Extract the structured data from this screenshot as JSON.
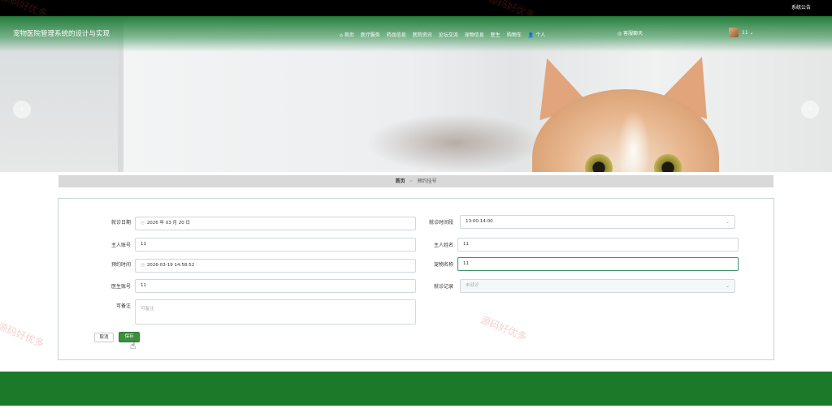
{
  "topbar": {
    "notice": "系统公告"
  },
  "watermark": "源码好优多",
  "nav": {
    "brand": "宠物医院管理系统的设计与实现",
    "items": [
      "⌂ 首页",
      "医疗服务",
      "药品信息",
      "医院资讯",
      "论坛交流",
      "宠物信息",
      "医生",
      "购物车",
      "👤 个人"
    ],
    "chat": "◎ 客服聊天",
    "user": "11 ⌄"
  },
  "carousel": {
    "prev": "‹",
    "next": "›"
  },
  "breadcrumb": {
    "home": "首页",
    "sep": ">",
    "current": "预约挂号"
  },
  "form": {
    "visit_date_label": "就诊日期",
    "visit_date_value": "2026 年 03 月 20 日",
    "slot_label": "就诊时间段",
    "slot_value": "13:00-14:00",
    "owner_account_label": "主人账号",
    "owner_account_value": "11",
    "owner_name_label": "主人姓名",
    "owner_name_value": "11",
    "booking_time_label": "预约时间",
    "booking_time_value": "2026-03-19 14:58:52",
    "pet_name_label": "宠物名称",
    "pet_name_value": "11",
    "doctor_account_label": "医生账号",
    "doctor_account_value": "11",
    "record_label": "就诊记录",
    "record_value": "未就诊",
    "remark_label": "可备注",
    "remark_placeholder": "可备注",
    "cancel": "取消",
    "save": "保存"
  },
  "colors": {
    "header_green": "#1a7a2a",
    "accent": "#3c8f3c"
  }
}
